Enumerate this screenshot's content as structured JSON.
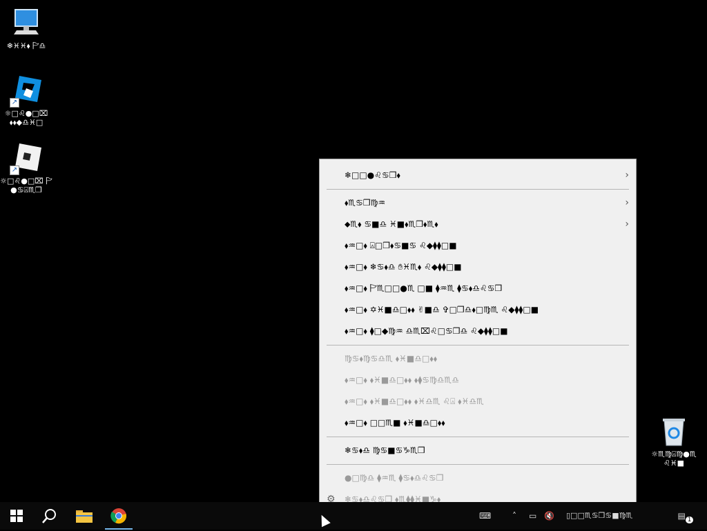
{
  "desktop": {
    "icons": [
      {
        "label": "❄︎♓︎♓︎⬧︎ 🏱︎♎︎"
      },
      {
        "label": "☼︎□︎♌︎●︎□︎⌧︎ ⬧︎⬧︎◆︎♎︎♓︎□︎"
      },
      {
        "label": "☼︎□︎♌︎●︎□︎⌧︎ 🏱︎●︎♋︎⍓︎♏︎❒︎"
      },
      {
        "label": "☼︎♏︎♍︎⍓︎♍︎●︎♏︎ ♌︎♓︎■︎"
      }
    ]
  },
  "context_menu": {
    "items": [
      {
        "label": "❄︎□︎□︎●︎♌︎♋︎❒︎⬧︎",
        "submenu": true,
        "disabled": false
      },
      {
        "label": "⬧︎♏︎♋︎❒︎♍︎♒︎",
        "submenu": true,
        "disabled": false
      },
      {
        "label": "⬥︎♏︎⬧︎ ♋︎■︎♎︎ ♓︎■︎⬧︎♏︎❒︎⬧︎♏︎⬧︎",
        "submenu": true,
        "disabled": false
      },
      {
        "label": "⬧︎♒︎□︎⬧︎ ⍓︎□︎❒︎⬧︎♋︎■︎♋︎ ♌︎◆︎⧫︎⧫︎□︎■︎",
        "disabled": false
      },
      {
        "label": "⬧︎♒︎□︎⬧︎ ❄︎♋︎⬧︎♎︎ ✋︎♓︎♏︎⬧︎ ♌︎◆︎⧫︎⧫︎□︎■︎",
        "disabled": false
      },
      {
        "label": "⬧︎♒︎□︎⬧︎ 🏱︎♏︎□︎□︎●︎♏︎ □︎■︎ ⧫︎♒︎♏︎ ⧫︎♋︎⬧︎♎︎♌︎♋︎❒︎",
        "disabled": false
      },
      {
        "label": "⬧︎♒︎□︎⬧︎ ✡︎♓︎■︎♎︎□︎⬧︎⬧︎ ✌︎■︎♎︎ ✞︎□︎❒︎♎︎⬧︎□︎♍︎♏︎ ♌︎◆︎⧫︎⧫︎□︎■︎",
        "disabled": false
      },
      {
        "label": "⬧︎♒︎□︎⬧︎ ⧫︎□︎◆︎♍︎♒︎ ♎︎♏︎⌧︎♌︎□︎♋︎❒︎♎︎ ♌︎◆︎⧫︎⧫︎□︎■︎",
        "disabled": false
      },
      {
        "label": "♍︎♋︎⬧︎♍︎♋︎♎︎♏︎ ⬧︎♓︎■︎♎︎□︎⬧︎⬧︎",
        "disabled": true
      },
      {
        "label": "⬧︎♒︎□︎⬧︎ ⬧︎♓︎■︎♎︎□︎⬧︎⬧︎ ⬧︎⧫︎♋︎♍︎♎︎♏︎♎︎",
        "disabled": true
      },
      {
        "label": "⬧︎♒︎□︎⬧︎ ⬧︎♓︎■︎♎︎□︎⬧︎⬧︎ ⬧︎♓︎♎︎♏︎ ♌︎⍓︎ ⬧︎♓︎♎︎♏︎",
        "disabled": true
      },
      {
        "label": "⬧︎♒︎□︎⬧︎ □︎□︎♏︎■︎ ⬧︎♓︎■︎♎︎□︎⬧︎⬧︎",
        "disabled": false
      },
      {
        "label": "❄︎♋︎⬧︎♎︎ ♍︎♋︎■︎♋︎♑︎♏︎❒︎",
        "disabled": false
      },
      {
        "label": "●︎□︎♍︎♎︎ ⧫︎♒︎♏︎ ⧫︎♋︎⬧︎♎︎♌︎♋︎❒︎",
        "disabled": true
      },
      {
        "label": "❄︎♋︎⬧︎♎︎♌︎♋︎❒︎ ⬧︎♏︎⧫︎⧫︎♓︎■︎♑︎⬧︎",
        "disabled": true
      }
    ]
  },
  "taskbar": {
    "tray_text": "▯︎□︎□︎♏︎♋︎❒︎♋︎■︎♍︎♏︎",
    "notification_count": "1"
  }
}
